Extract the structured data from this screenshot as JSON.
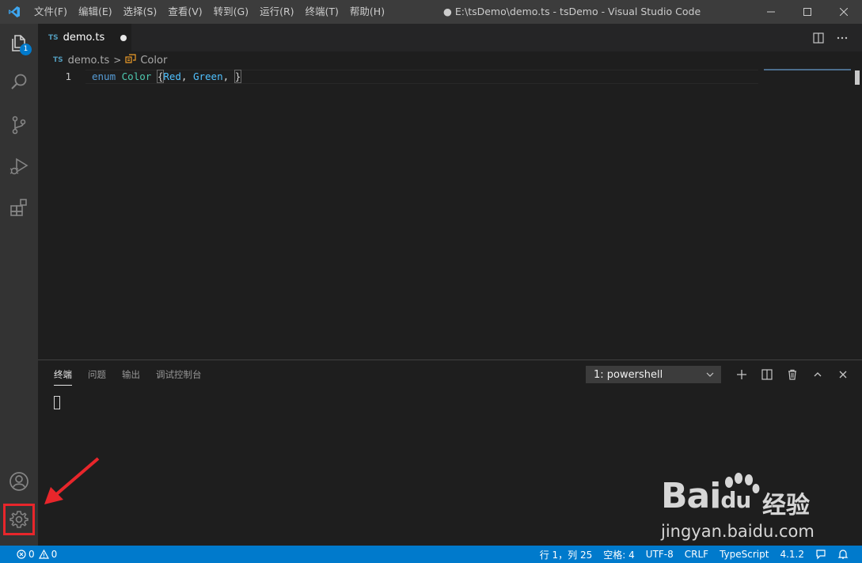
{
  "menu": [
    "文件(F)",
    "编辑(E)",
    "选择(S)",
    "查看(V)",
    "转到(G)",
    "运行(R)",
    "终端(T)",
    "帮助(H)"
  ],
  "window_title": "● E:\\tsDemo\\demo.ts - tsDemo - Visual Studio Code",
  "activity": {
    "explorer_badge": "1"
  },
  "tab": {
    "lang_badge": "TS",
    "label": "demo.ts"
  },
  "breadcrumb": {
    "file": "demo.ts",
    "separator": ">",
    "symbol": "Color"
  },
  "editor": {
    "line_number": "1",
    "code": {
      "kw": "enum",
      "type": "Color",
      "brace_open": "{",
      "m1": "Red",
      "comma1": ", ",
      "m2": "Green",
      "comma2": ", ",
      "brace_close": "}"
    }
  },
  "panel": {
    "tabs": [
      "终端",
      "问题",
      "输出",
      "调试控制台"
    ],
    "terminal_select": "1: powershell"
  },
  "statusbar": {
    "errors": "0",
    "warnings": "0",
    "position": "行 1，列 25",
    "spaces": "空格: 4",
    "encoding": "UTF-8",
    "eol": "CRLF",
    "language": "TypeScript",
    "ts_version": "4.1.2"
  },
  "watermark": {
    "brand": "Bai",
    "brand2": "du",
    "cn": "经验",
    "url": "jingyan.baidu.com"
  },
  "colors": {
    "accent": "#007acc",
    "highlight_box": "#e8262b"
  }
}
